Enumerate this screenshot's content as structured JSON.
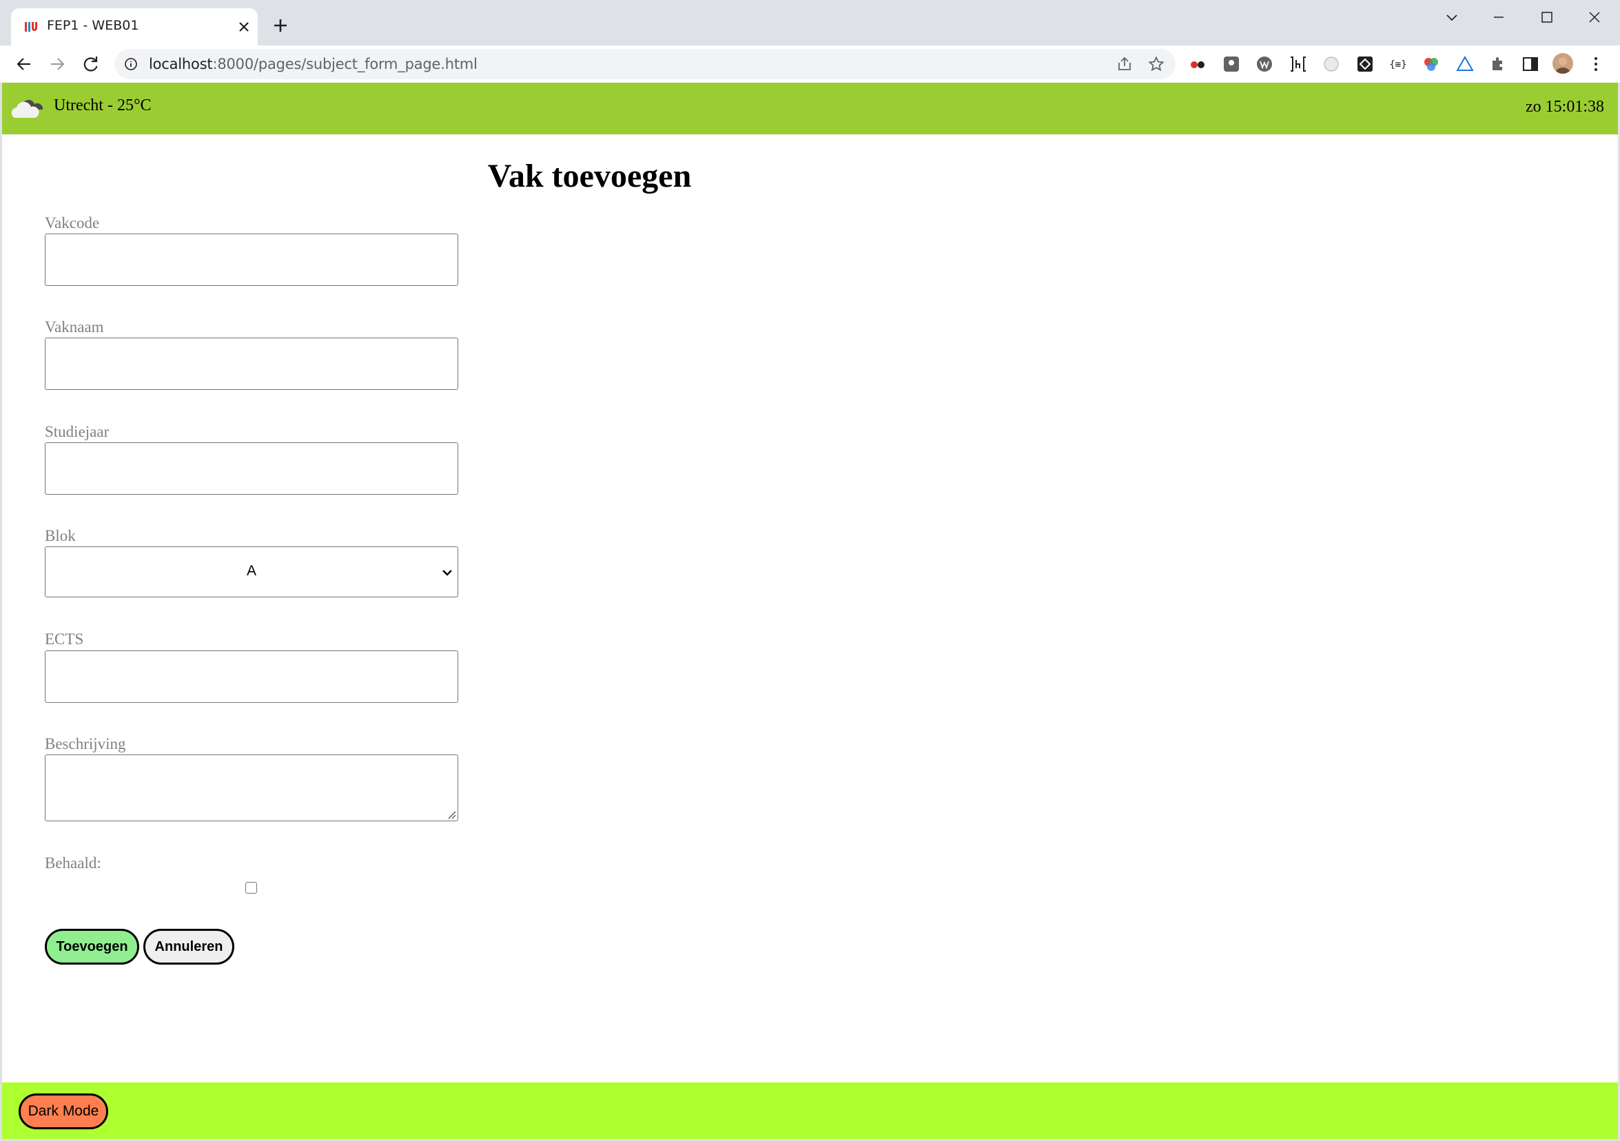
{
  "browser": {
    "tab_title": "FEP1 - WEB01",
    "url_host": "localhost",
    "url_rest": ":8000/pages/subject_form_page.html"
  },
  "header": {
    "weather": "Utrecht - 25°C",
    "clock": "zo 15:01:38"
  },
  "page": {
    "title": "Vak toevoegen"
  },
  "form": {
    "vakcode_label": "Vakcode",
    "vakcode_value": "",
    "vaknaam_label": "Vaknaam",
    "vaknaam_value": "",
    "studiejaar_label": "Studiejaar",
    "studiejaar_value": "",
    "blok_label": "Blok",
    "blok_selected": "A",
    "ects_label": "ECTS",
    "ects_value": "",
    "beschrijving_label": "Beschrijving",
    "beschrijving_value": "",
    "behaald_label": "Behaald:",
    "behaald_checked": false,
    "submit_label": "Toevoegen",
    "cancel_label": "Annuleren"
  },
  "footer": {
    "dark_mode_label": "Dark Mode"
  },
  "colors": {
    "header_bg": "#9acd32",
    "footer_bg": "#adff2f",
    "submit_bg": "#90ee90",
    "dark_mode_bg": "#ff7f50"
  }
}
